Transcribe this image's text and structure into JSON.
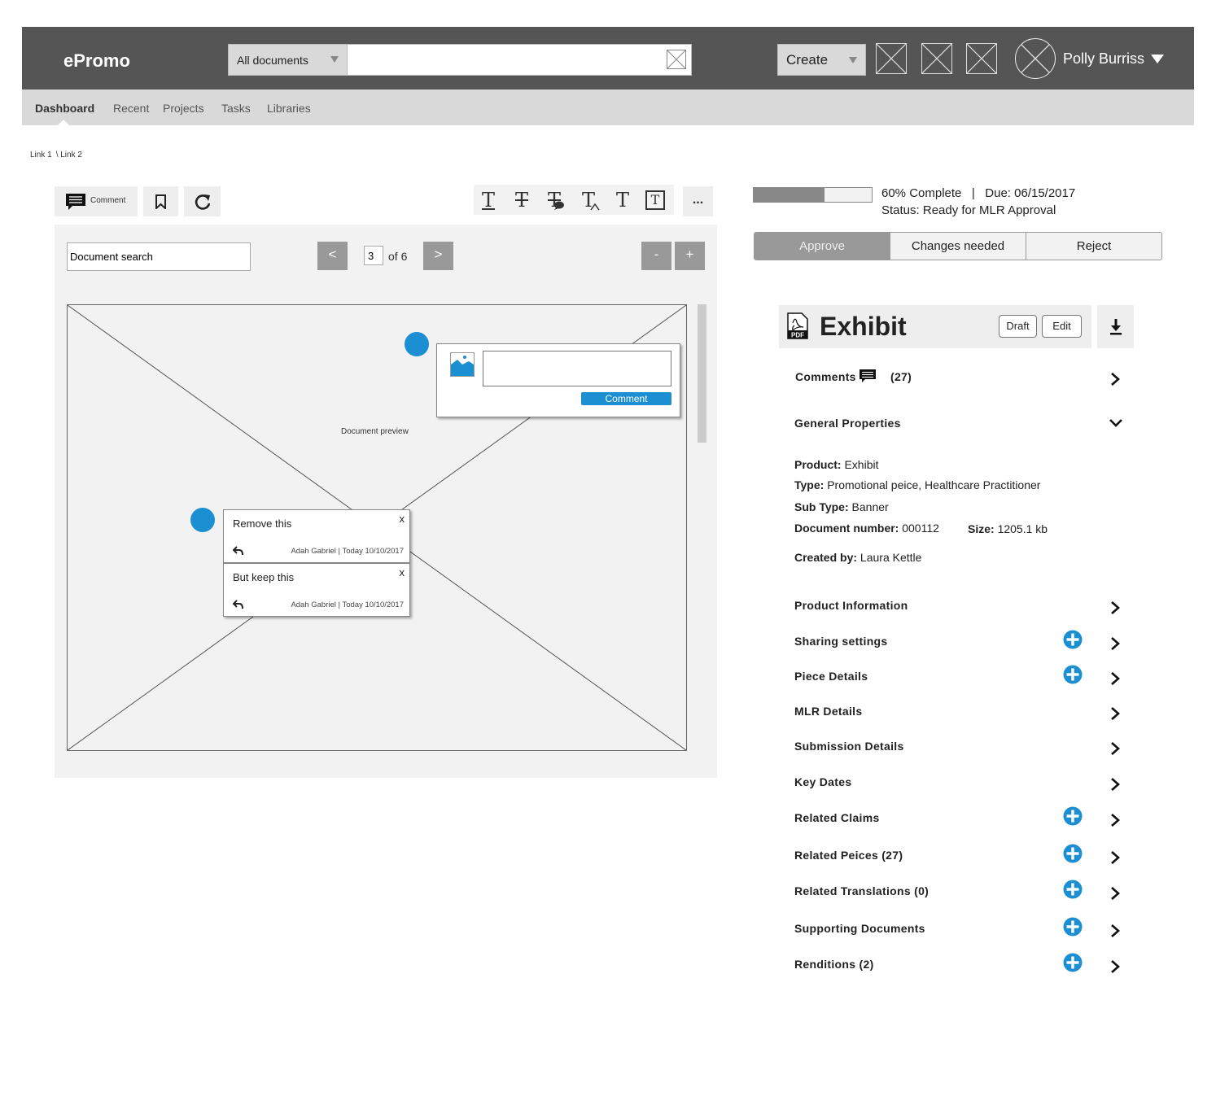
{
  "app": {
    "title": "ePromo"
  },
  "search": {
    "scope": "All documents",
    "query": "",
    "placeholder": ""
  },
  "create": {
    "label": "Create"
  },
  "user": {
    "name": "Polly Burriss"
  },
  "nav": {
    "items": [
      {
        "label": "Dashboard",
        "active": true
      },
      {
        "label": "Recent",
        "active": false
      },
      {
        "label": "Projects",
        "active": false
      },
      {
        "label": "Tasks",
        "active": false
      },
      {
        "label": "Libraries",
        "active": false
      }
    ]
  },
  "breadcrumb": {
    "link1": "Link 1",
    "link2": "\\ Link 2"
  },
  "toolbar": {
    "comment_label": "Comment",
    "more_label": "...",
    "format_glyph": "T"
  },
  "viewer": {
    "search_value": "Document search",
    "prev_label": "<",
    "next_label": ">",
    "page_value": "3",
    "page_total": "of 6",
    "zoom_out_label": "-",
    "zoom_in_label": "+",
    "preview_label": "Document preview"
  },
  "new_comment": {
    "button_label": "Comment",
    "text": ""
  },
  "threads": [
    {
      "text": "Remove  this",
      "close": "x",
      "meta": "Adah Gabriel | Today 10/10/2017"
    },
    {
      "text": "But keep this",
      "close": "x",
      "meta": "Adah Gabriel | Today 10/10/2017"
    }
  ],
  "progress": {
    "fraction": 0.6,
    "text": "60% Complete   |   Due: 06/15/2017",
    "status": "Status: Ready for MLR Approval"
  },
  "decision": {
    "approve": "Approve",
    "changes": "Changes needed",
    "reject": "Reject"
  },
  "document": {
    "title": "Exhibit",
    "draft_label": "Draft",
    "edit_label": "Edit",
    "pdf_badge": "PDF"
  },
  "comments": {
    "label": "Comments",
    "count": "(27)"
  },
  "general": {
    "label": "General Properties",
    "product_label": "Product:",
    "product": "Exhibit",
    "type_label": "Type:",
    "type": "Promotional peice, Healthcare Practitioner",
    "subtype_label": "Sub Type:",
    "subtype": "Banner",
    "docnum_label": "Document number:",
    "docnum": "000112",
    "size_label": "Size:",
    "size": "1205.1 kb",
    "created_label": "Created by:",
    "created": "Laura Kettle"
  },
  "sections": [
    {
      "label": "Product Information",
      "has_add": false
    },
    {
      "label": "Sharing settings",
      "has_add": true
    },
    {
      "label": "Piece Details",
      "has_add": true
    },
    {
      "label": "MLR Details",
      "has_add": false
    },
    {
      "label": "Submission Details",
      "has_add": false
    },
    {
      "label": "Key Dates",
      "has_add": false
    },
    {
      "label": "Related Claims",
      "has_add": true
    },
    {
      "label": "Related Peices  (27)",
      "has_add": true
    },
    {
      "label": "Related Translations  (0)",
      "has_add": true
    },
    {
      "label": "Supporting Documents",
      "has_add": true
    },
    {
      "label": "Renditions  (2)",
      "has_add": true
    }
  ],
  "colors": {
    "accent": "#1b8fd2",
    "header": "#555555",
    "subnav": "#d9d9d9"
  }
}
